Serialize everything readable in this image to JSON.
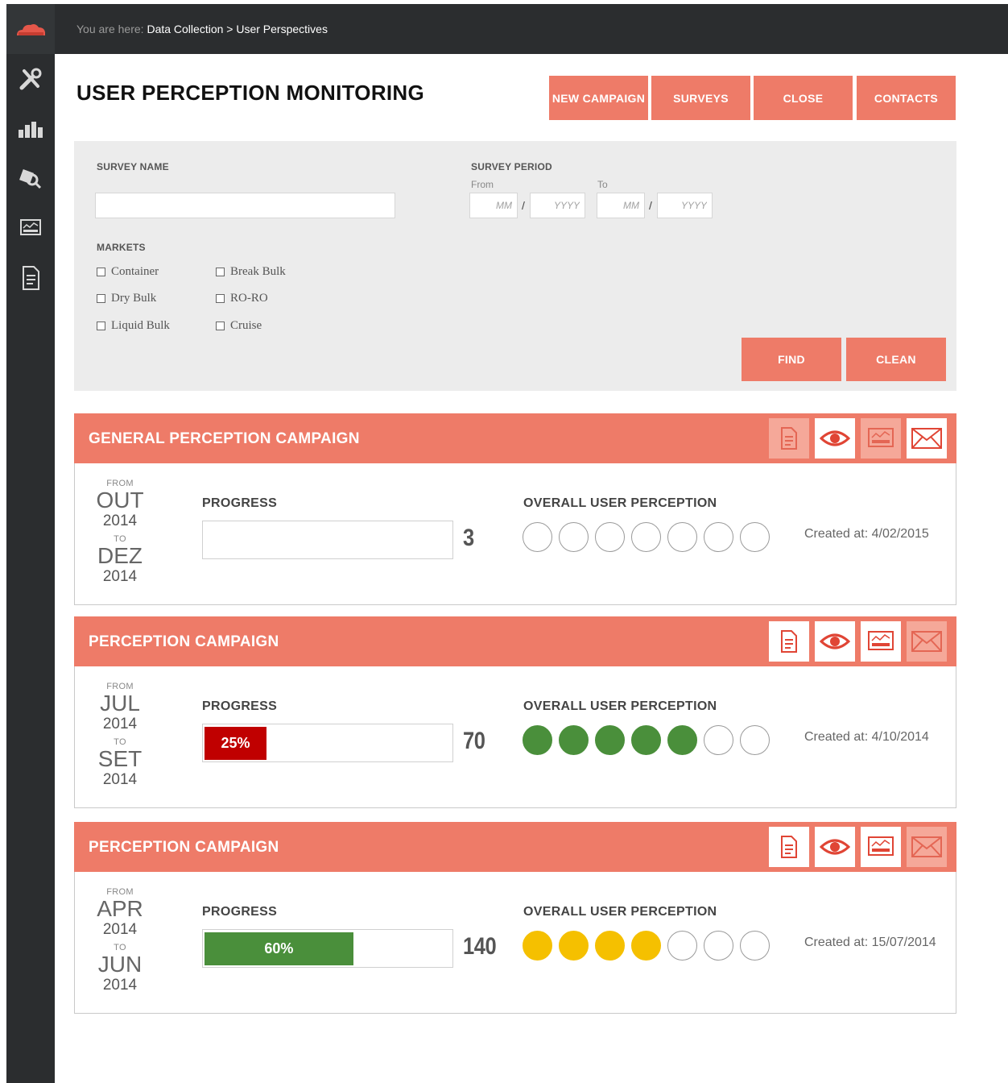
{
  "header": {
    "breadcrumb_label": "You are here:",
    "breadcrumb_path": "Data Collection > User Perspectives"
  },
  "page_title": "USER PERCEPTION MONITORING",
  "actions": {
    "new_campaign": "NEW CAMPAIGN",
    "surveys": "SURVEYS",
    "close": "CLOSE",
    "contacts": "CONTACTS"
  },
  "filter": {
    "survey_name_label": "SURVEY NAME",
    "survey_name_value": "",
    "survey_period_label": "SURVEY PERIOD",
    "from_label": "From",
    "to_label": "To",
    "month_placeholder": "MM",
    "year_placeholder": "YYYY",
    "separator": "/",
    "markets_label": "MARKETS",
    "markets": [
      "Container",
      "Break Bulk",
      "Dry Bulk",
      "RO-RO",
      "Liquid Bulk",
      "Cruise"
    ],
    "find": "FIND",
    "clean": "CLEAN"
  },
  "campaigns": [
    {
      "title": "GENERAL PERCEPTION CAMPAIGN",
      "from_label": "FROM",
      "from_month": "OUT",
      "from_year": "2014",
      "to_label": "TO",
      "to_month": "DEZ",
      "to_year": "2014",
      "progress_label": "PROGRESS",
      "progress_percent": 0,
      "progress_text": "",
      "count": "3",
      "perception_label": "OVERALL USER PERCEPTION",
      "rating_filled": 0,
      "rating_max": 7,
      "rating_color": "",
      "created": "Created at: 4/02/2015",
      "actions_enabled": [
        false,
        true,
        false,
        true
      ]
    },
    {
      "title": "PERCEPTION CAMPAIGN",
      "from_label": "FROM",
      "from_month": "JUL",
      "from_year": "2014",
      "to_label": "TO",
      "to_month": "SET",
      "to_year": "2014",
      "progress_label": "PROGRESS",
      "progress_percent": 25,
      "progress_text": "25%",
      "progress_color": "#c00000",
      "count": "70",
      "perception_label": "OVERALL USER PERCEPTION",
      "rating_filled": 5,
      "rating_max": 7,
      "rating_color": "#4a8f3b",
      "created": "Created at: 4/10/2014",
      "actions_enabled": [
        true,
        true,
        true,
        false
      ]
    },
    {
      "title": "PERCEPTION CAMPAIGN",
      "from_label": "FROM",
      "from_month": "APR",
      "from_year": "2014",
      "to_label": "TO",
      "to_month": "JUN",
      "to_year": "2014",
      "progress_label": "PROGRESS",
      "progress_percent": 60,
      "progress_text": "60%",
      "progress_color": "#4a8f3b",
      "count": "140",
      "perception_label": "OVERALL USER PERCEPTION",
      "rating_filled": 4,
      "rating_max": 7,
      "rating_color": "#f5c000",
      "created": "Created at: 15/07/2014",
      "actions_enabled": [
        true,
        true,
        true,
        false
      ]
    }
  ],
  "icons": {
    "logo": "cloud-logo-icon",
    "nav": [
      "tools-icon",
      "bar-chart-icon",
      "search-data-icon",
      "dashboard-icon",
      "document-icon"
    ],
    "card_actions": [
      "document-icon",
      "eye-icon",
      "dashboard-icon",
      "envelope-icon"
    ]
  },
  "colors": {
    "accent": "#ee7b68",
    "sidebar": "#2b2d2f",
    "panel": "#ececec"
  }
}
